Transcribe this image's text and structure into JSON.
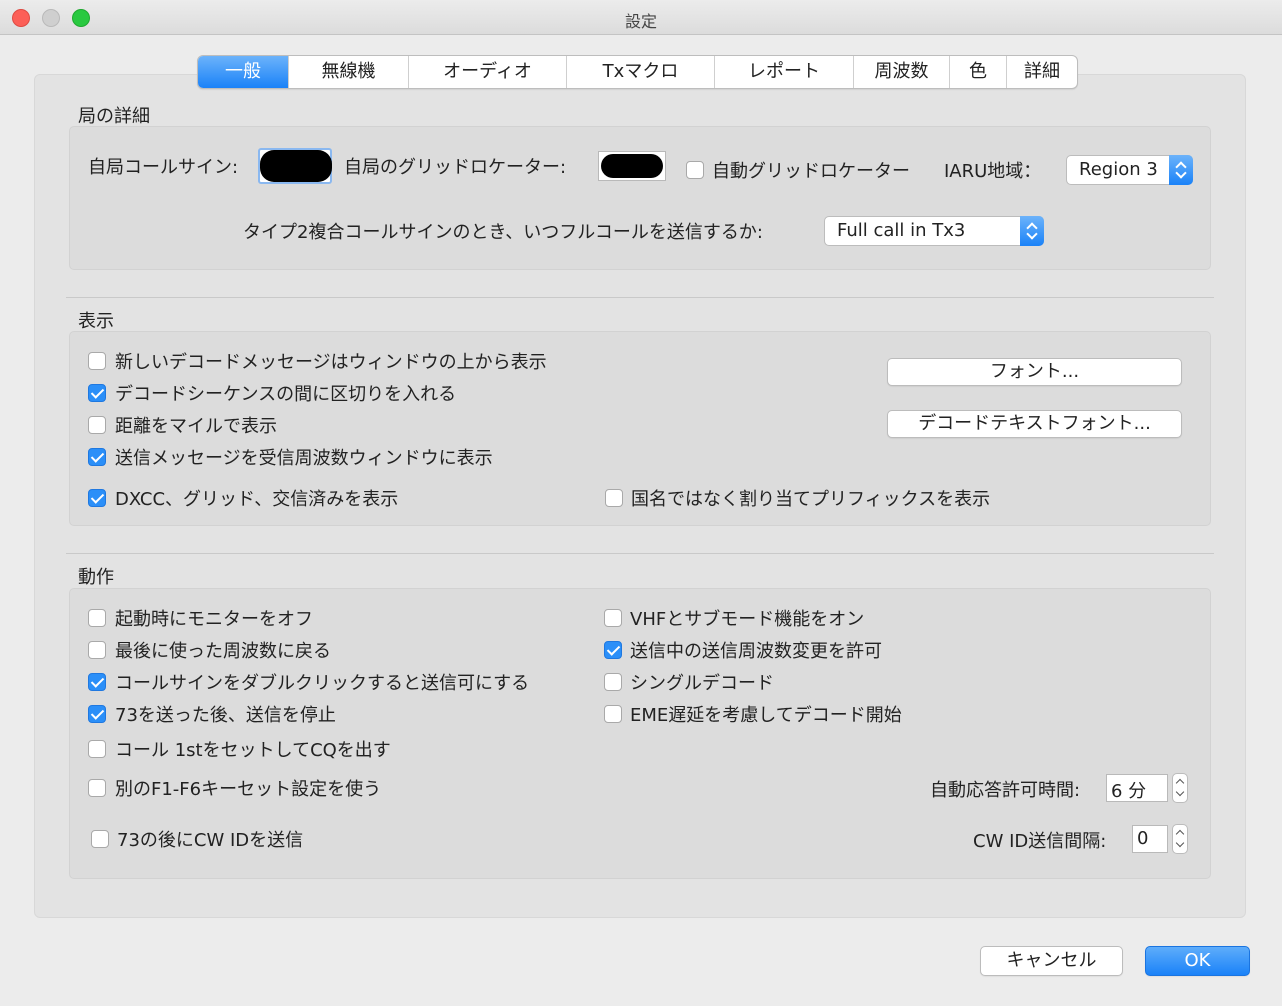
{
  "window": {
    "title": "設定"
  },
  "tabs": [
    {
      "label": "一般",
      "active": true
    },
    {
      "label": "無線機"
    },
    {
      "label": "オーディオ"
    },
    {
      "label": "Txマクロ"
    },
    {
      "label": "レポート"
    },
    {
      "label": "周波数"
    },
    {
      "label": "色"
    },
    {
      "label": "詳細"
    }
  ],
  "station": {
    "title": "局の詳細",
    "callsign_label": "自局コールサイン:",
    "grid_label": "自局のグリッドロケーター:",
    "auto_grid_label": "自動グリッドロケーター",
    "iaru_label": "IARU地域：",
    "iaru_value": "Region 3",
    "type2_label": "タイプ2複合コールサインのとき、いつフルコールを送信するか:",
    "type2_value": "Full call in Tx3"
  },
  "display": {
    "title": "表示",
    "items": [
      {
        "label": "新しいデコードメッセージはウィンドウの上から表示",
        "checked": false
      },
      {
        "label": "デコードシーケンスの間に区切りを入れる",
        "checked": true
      },
      {
        "label": "距離をマイルで表示",
        "checked": false
      },
      {
        "label": "送信メッセージを受信周波数ウィンドウに表示",
        "checked": true
      },
      {
        "label": "DXCC、グリッド、交信済みを表示",
        "checked": true
      },
      {
        "label": "国名ではなく割り当てプリフィックスを表示",
        "checked": false
      }
    ],
    "font_button": "フォント...",
    "decode_font_button": "デコードテキストフォント..."
  },
  "behavior": {
    "title": "動作",
    "left_items": [
      {
        "label": "起動時にモニターをオフ",
        "checked": false
      },
      {
        "label": "最後に使った周波数に戻る",
        "checked": false
      },
      {
        "label": "コールサインをダブルクリックすると送信可にする",
        "checked": true
      },
      {
        "label": "73を送った後、送信を停止",
        "checked": true
      },
      {
        "label": "コール 1stをセットしてCQを出す",
        "checked": false
      },
      {
        "label": "別のF1-F6キーセット設定を使う",
        "checked": false
      },
      {
        "label": "73の後にCW IDを送信",
        "checked": false
      }
    ],
    "right_items": [
      {
        "label": "VHFとサブモード機能をオン",
        "checked": false
      },
      {
        "label": "送信中の送信周波数変更を許可",
        "checked": true
      },
      {
        "label": "シングルデコード",
        "checked": false
      },
      {
        "label": "EME遅延を考慮してデコード開始",
        "checked": false
      }
    ],
    "auto_reply_label": "自動応答許可時間:",
    "auto_reply_value": "6 分",
    "cwid_label": "CW ID送信間隔:",
    "cwid_value": "0"
  },
  "footer": {
    "cancel": "キャンセル",
    "ok": "OK"
  },
  "colors": {
    "accent": "#1a82f8",
    "close": "#fc5f57",
    "minimize": "#c9c9c9",
    "zoom": "#29c940"
  }
}
